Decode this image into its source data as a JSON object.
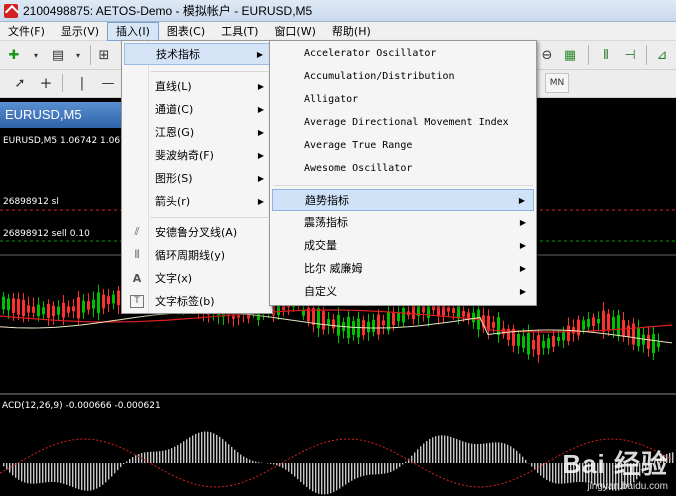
{
  "window": {
    "title": "2100498875: AETOS-Demo - 模拟帐户 - EURUSD,M5"
  },
  "menubar": {
    "items": [
      "文件(F)",
      "显示(V)",
      "插入(I)",
      "图表(C)",
      "工具(T)",
      "窗口(W)",
      "帮助(H)"
    ]
  },
  "toolbar": {
    "timeframe_label": "MN"
  },
  "chart": {
    "tab_label": "EURUSD,M5",
    "symbol_info": "EURUSD,M5  1.06742 1.067",
    "line1_label": "26898912 sl",
    "line2_label": "26898912 sell 0.10",
    "macd_label": "ACD(12,26,9) -0.000666 -0.000621",
    "colors": {
      "bull": "#00c000",
      "bear": "#ff3030",
      "line_red": "#e02020",
      "line_green": "#00a000"
    }
  },
  "insert_menu": {
    "items": [
      {
        "label": "技术指标",
        "has_submenu": true,
        "highlighted": true
      },
      {
        "label": "直线(L)",
        "has_submenu": true
      },
      {
        "label": "通道(C)",
        "has_submenu": true
      },
      {
        "label": "江恩(G)",
        "has_submenu": true
      },
      {
        "label": "斐波纳奇(F)",
        "has_submenu": true
      },
      {
        "label": "图形(S)",
        "has_submenu": true
      },
      {
        "label": "箭头(r)",
        "has_submenu": true
      },
      {
        "label": "安德鲁分叉线(A)",
        "icon": "andrews-pitchfork-icon"
      },
      {
        "label": "循环周期线(y)",
        "icon": "cycle-lines-icon"
      },
      {
        "label": "文字(x)",
        "icon": "text-icon",
        "icon_text": "A"
      },
      {
        "label": "文字标签(b)",
        "icon": "text-label-icon",
        "icon_text": "T"
      }
    ]
  },
  "indicator_menu": {
    "items": [
      {
        "label": "Accelerator Oscillator"
      },
      {
        "label": "Accumulation/Distribution"
      },
      {
        "label": "Alligator"
      },
      {
        "label": "Average Directional Movement Index"
      },
      {
        "label": "Average True Range"
      },
      {
        "label": "Awesome Oscillator"
      },
      {
        "label": "趋势指标",
        "has_submenu": true,
        "highlighted": true
      },
      {
        "label": "震荡指标",
        "has_submenu": true
      },
      {
        "label": "成交量",
        "has_submenu": true
      },
      {
        "label": "比尔 威廉姆",
        "has_submenu": true
      },
      {
        "label": "自定义",
        "has_submenu": true
      }
    ]
  },
  "watermark": {
    "logo": "Bai 经验",
    "url": "jingyan.baidu.com"
  }
}
